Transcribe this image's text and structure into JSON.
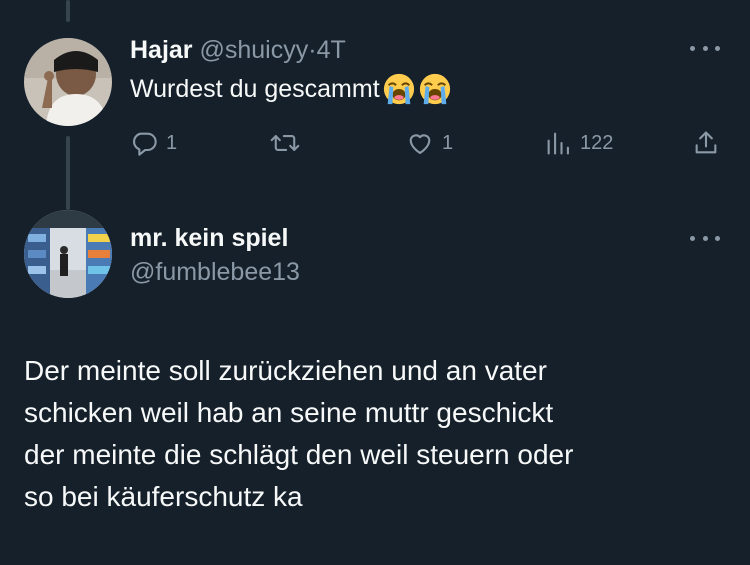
{
  "colors": {
    "background": "#15202b",
    "text_primary": "#f7f9f9",
    "text_secondary": "#8b98a5",
    "thread_line": "#38444d"
  },
  "tweet_parent": {
    "display_name": "Hajar",
    "handle": "@shuicyy",
    "separator": "·",
    "time": "4T",
    "text": "Wurdest du gescammt",
    "emojis": [
      "loudly-crying-face-icon",
      "loudly-crying-face-icon"
    ],
    "actions": {
      "reply_count": "1",
      "retweet_count": "",
      "like_count": "1",
      "views_count": "122"
    },
    "icons": {
      "reply": "reply-icon",
      "retweet": "retweet-icon",
      "like": "heart-icon",
      "views": "views-chart-icon",
      "share": "share-icon",
      "more": "more-options-icon"
    }
  },
  "tweet_reply": {
    "display_name": "mr. kein spiel",
    "handle": "@fumblebee13",
    "text_lines": [
      "Der meinte soll zurückziehen und an vater",
      "schicken weil hab an seine muttr geschickt",
      "der meinte die schlägt den weil steuern oder",
      "so bei käuferschutz ka"
    ]
  }
}
